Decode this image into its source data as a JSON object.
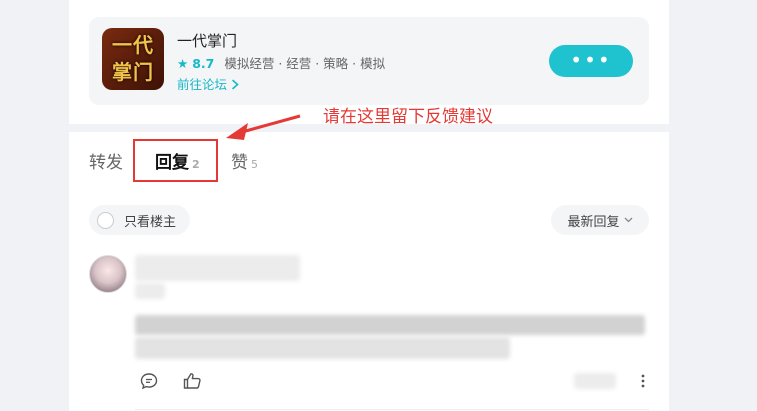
{
  "game": {
    "icon_text": "一代掌门",
    "name": "一代掌门",
    "score": "8.7",
    "tags": "模拟经营 · 经营 · 策略 · 模拟",
    "forum_link": "前往论坛",
    "more_label": "•••"
  },
  "annotation": {
    "text": "请在这里留下反馈建议",
    "color": "#e53935"
  },
  "tabs": [
    {
      "label": "转发",
      "count": ""
    },
    {
      "label": "回复",
      "count": "2"
    },
    {
      "label": "赞",
      "count": "5"
    }
  ],
  "filters": {
    "owner_only": "只看楼主",
    "sort": "最新回复"
  },
  "icons": {
    "star": "star-icon",
    "chevron": "chevron-right-icon",
    "comment": "comment-icon",
    "like": "thumbs-up-icon",
    "more": "more-vertical-icon"
  },
  "colors": {
    "accent": "#1fc2cf",
    "annotation": "#e53935"
  }
}
